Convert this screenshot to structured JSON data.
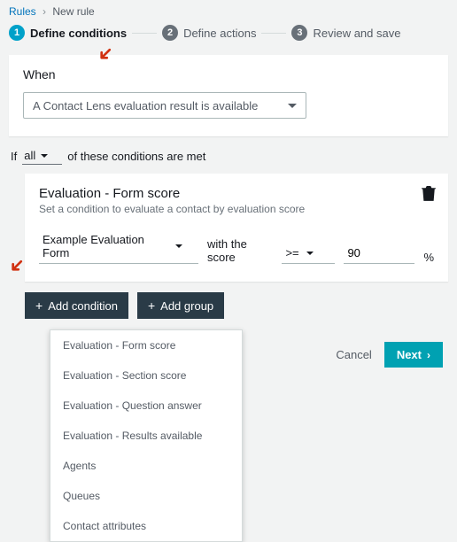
{
  "breadcrumb": {
    "root": "Rules",
    "current": "New rule"
  },
  "stepper": {
    "steps": [
      {
        "num": "1",
        "label": "Define conditions"
      },
      {
        "num": "2",
        "label": "Define actions"
      },
      {
        "num": "3",
        "label": "Review and save"
      }
    ]
  },
  "when": {
    "label": "When",
    "selected": "A Contact Lens evaluation result is available"
  },
  "condition_clause": {
    "prefix": "If",
    "mode": "all",
    "suffix": "of these conditions are met"
  },
  "form_score": {
    "title": "Evaluation - Form score",
    "subtitle": "Set a condition to evaluate a contact by evaluation score",
    "form_select": "Example Evaluation Form",
    "with_score": "with the score",
    "operator": ">=",
    "value": "90",
    "unit": "%"
  },
  "buttons": {
    "add_condition": "Add condition",
    "add_group": "Add group",
    "cancel": "Cancel",
    "next": "Next"
  },
  "condition_menu": {
    "items": [
      "Evaluation - Form score",
      "Evaluation - Section score",
      "Evaluation - Question answer",
      "Evaluation - Results available",
      "Agents",
      "Queues",
      "Contact attributes"
    ]
  }
}
